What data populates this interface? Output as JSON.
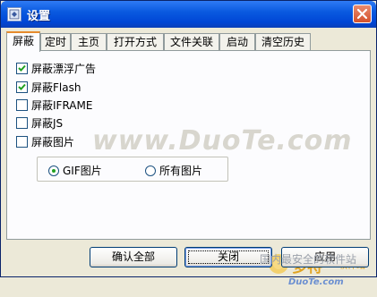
{
  "window": {
    "title": "设置",
    "accent": "#0a5ae0"
  },
  "tabs": [
    {
      "label": "屏蔽",
      "active": true
    },
    {
      "label": "定时",
      "active": false
    },
    {
      "label": "主页",
      "active": false
    },
    {
      "label": "打开方式",
      "active": false
    },
    {
      "label": "文件关联",
      "active": false
    },
    {
      "label": "启动",
      "active": false
    },
    {
      "label": "清空历史",
      "active": false
    }
  ],
  "options": [
    {
      "label": "屏蔽漂浮广告",
      "checked": true
    },
    {
      "label": "屏蔽Flash",
      "checked": true
    },
    {
      "label": "屏蔽IFRAME",
      "checked": false
    },
    {
      "label": "屏蔽JS",
      "checked": false
    },
    {
      "label": "屏蔽图片",
      "checked": false
    }
  ],
  "image_mode": {
    "options": [
      {
        "label": "GIF图片",
        "selected": true
      },
      {
        "label": "所有图片",
        "selected": false
      }
    ]
  },
  "buttons": {
    "confirm_all": "确认全部",
    "close": "关闭",
    "apply": "应用"
  },
  "watermarks": {
    "center": "www.DuoTe.com",
    "logo_cn": "多特",
    "logo_sub": "软件站",
    "logo_en": "DuoTe.com",
    "bottom": "国内最安全的软件站"
  },
  "icons": {
    "app": "app-icon",
    "close": "close-icon",
    "check": "check-icon"
  }
}
